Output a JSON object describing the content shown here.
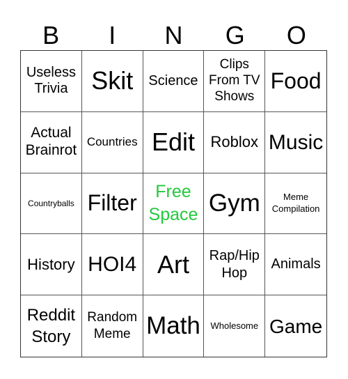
{
  "header": {
    "letters": [
      "B",
      "I",
      "N",
      "G",
      "O"
    ]
  },
  "colors": {
    "free_space": "#22c93b",
    "grid_line": "#555555",
    "text": "#000000"
  },
  "board": {
    "rows": [
      [
        "Useless\nTrivia",
        "Skit",
        "Science",
        "Clips\nFrom TV\nShows",
        "Food"
      ],
      [
        "Actual\nBrainrot",
        "Countries",
        "Edit",
        "Roblox",
        "Music"
      ],
      [
        "Countryballs",
        "Filter",
        "Free\nSpace",
        "Gym",
        "Meme\nCompilation"
      ],
      [
        "History",
        "HOI4",
        "Art",
        "Rap/Hip\nHop",
        "Animals"
      ],
      [
        "Reddit\nStory",
        "Random\nMeme",
        "Math",
        "Wholesome",
        "Game"
      ]
    ],
    "free_space": {
      "row": 2,
      "col": 2
    }
  }
}
